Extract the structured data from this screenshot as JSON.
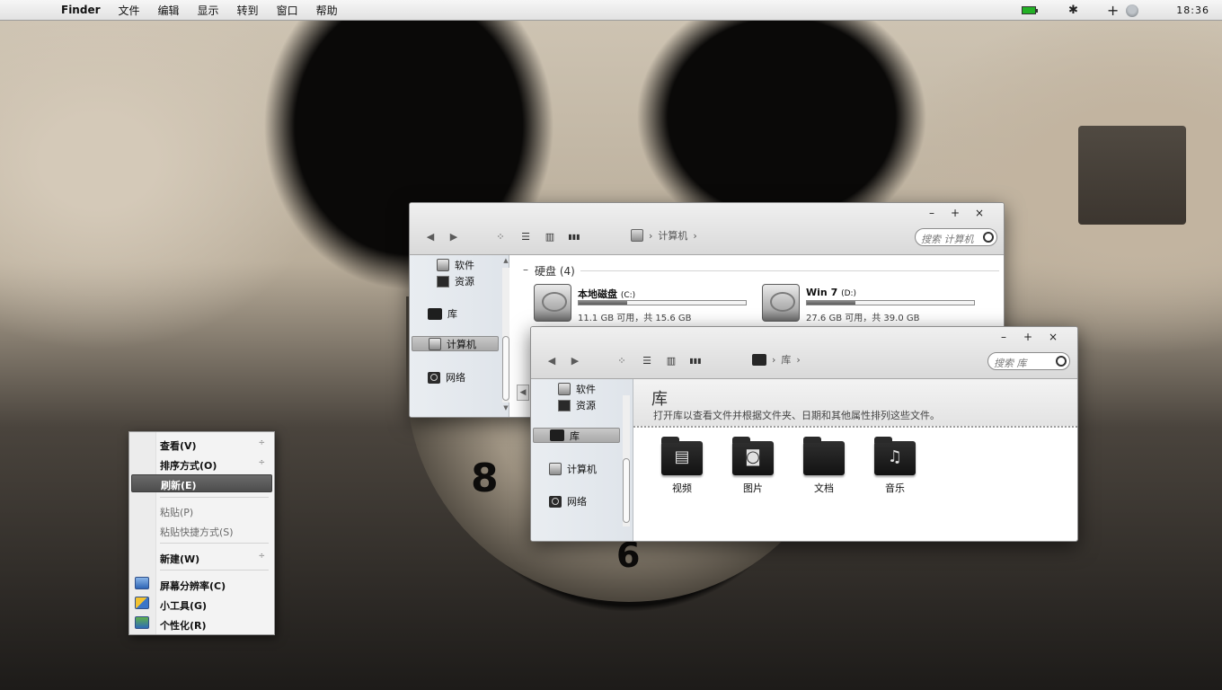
{
  "menubar": {
    "app_name": "Finder",
    "items": [
      "文件",
      "编辑",
      "显示",
      "转到",
      "窗口",
      "帮助"
    ],
    "apple_glyph": "",
    "bluetooth_glyph": "✱",
    "plus_glyph": "+",
    "time": "18:36",
    "icons": [
      "apple-icon",
      "battery-icon",
      "bluetooth-icon",
      "add-icon",
      "user-icon"
    ]
  },
  "desktop": {
    "clock_numbers": [
      "8",
      "6"
    ]
  },
  "window_computer": {
    "controls": {
      "minimize": "–",
      "maximize": "+",
      "close": "×"
    },
    "toolbar": {
      "back": "◀",
      "forward": "▶",
      "view_icons": "⁘",
      "view_list": "☰",
      "view_columns": "▥",
      "view_coverflow": "▮▮▮"
    },
    "breadcrumb": [
      "计算机"
    ],
    "breadcrumb_sep": "›",
    "search_placeholder": "搜索 计算机",
    "sidebar": [
      "软件",
      "资源",
      "库",
      "计算机",
      "网络"
    ],
    "group_title": "硬盘 (4)",
    "group_collapse": "–",
    "drives": [
      {
        "name": "本地磁盘",
        "letter": "(C:)",
        "info": "11.1 GB 可用，共 15.6 GB",
        "used_fraction": 0.29
      },
      {
        "name": "Win 7",
        "letter": "(D:)",
        "info": "27.6 GB 可用，共 39.0 GB",
        "used_fraction": 0.29
      }
    ]
  },
  "window_library": {
    "controls": {
      "minimize": "–",
      "maximize": "+",
      "close": "×"
    },
    "toolbar": {
      "back": "◀",
      "forward": "▶",
      "view_icons": "⁘",
      "view_list": "☰",
      "view_columns": "▥",
      "view_coverflow": "▮▮▮"
    },
    "breadcrumb": [
      "库"
    ],
    "breadcrumb_sep": "›",
    "search_placeholder": "搜索 库",
    "sidebar": [
      "软件",
      "资源",
      "库",
      "计算机",
      "网络"
    ],
    "title": "库",
    "subtitle": "打开库以查看文件并根据文件夹、日期和其他属性排列这些文件。",
    "libraries": [
      {
        "label": "视频",
        "glyph": "▤"
      },
      {
        "label": "图片",
        "glyph": "◙"
      },
      {
        "label": "文档",
        "glyph": ""
      },
      {
        "label": "音乐",
        "glyph": "♫"
      }
    ]
  },
  "context_menu": {
    "arrow_glyph": "÷",
    "items": [
      {
        "label": "查看(V)",
        "submenu": true
      },
      {
        "label": "排序方式(O)",
        "submenu": true
      },
      {
        "label": "刷新(E)",
        "highlighted": true
      },
      {
        "label": "粘贴(P)",
        "disabled": true
      },
      {
        "label": "粘贴快捷方式(S)",
        "disabled": true
      },
      {
        "label": "新建(W)",
        "submenu": true
      },
      {
        "label": "屏幕分辨率(C)"
      },
      {
        "label": "小工具(G)"
      },
      {
        "label": "个性化(R)"
      }
    ]
  }
}
